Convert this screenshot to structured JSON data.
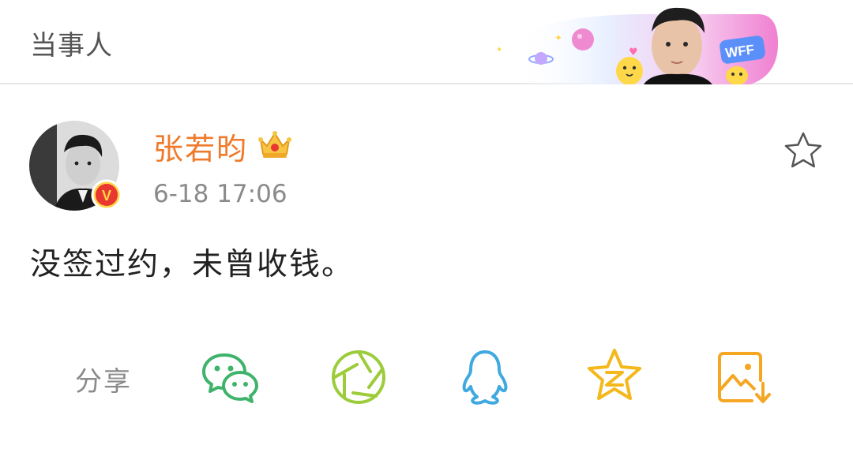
{
  "header": {
    "title": "当事人",
    "banner": {
      "badge_text": "WFF"
    }
  },
  "post": {
    "author": "张若昀",
    "author_badge": "V",
    "timestamp": "6-18 17:06",
    "content": "没签过约，未曾收钱。",
    "favorite_icon": "star-outline-icon"
  },
  "share": {
    "label": "分享",
    "targets": [
      {
        "name": "wechat",
        "icon": "wechat-icon",
        "color": "#3fb36b"
      },
      {
        "name": "moments",
        "icon": "wechat-moments-icon",
        "color": "#9ccc3a"
      },
      {
        "name": "qq",
        "icon": "qq-icon",
        "color": "#3fa9e0"
      },
      {
        "name": "qzone",
        "icon": "qzone-icon",
        "color": "#f5b81c"
      },
      {
        "name": "save-image",
        "icon": "save-image-icon",
        "color": "#f5a623"
      }
    ]
  },
  "colors": {
    "username": "#ef7a2b",
    "verified": "#e8382f",
    "text_secondary": "#8a8a8a"
  }
}
